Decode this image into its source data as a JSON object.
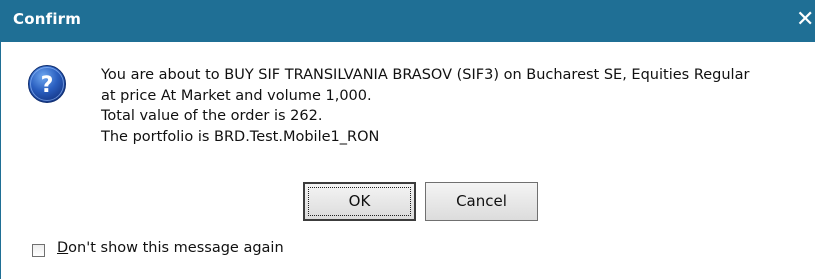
{
  "window": {
    "title": "Confirm",
    "close_glyph": "✕",
    "titlebar_color": "#1f6f95"
  },
  "icon": {
    "name": "question-icon",
    "glyph": "?",
    "color": "#1f4fa8"
  },
  "message": {
    "line1": "You are about to BUY SIF TRANSILVANIA BRASOV (SIF3) on Bucharest SE, Equities Regular",
    "line2": "at price At Market and volume 1,000.",
    "line3": "Total value of the order is 262.",
    "line4": "The portfolio is BRD.Test.Mobile1_RON"
  },
  "buttons": {
    "ok_label": "OK",
    "cancel_label": "Cancel"
  },
  "checkbox": {
    "checked": false,
    "label_first_letter": "D",
    "label_rest": "on't show this message again"
  }
}
